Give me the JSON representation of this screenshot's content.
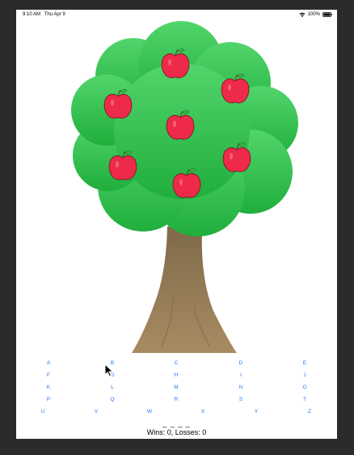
{
  "status": {
    "time": "9:10 AM",
    "date": "Thu Apr 9",
    "battery": "100%",
    "icons": [
      "wifi-icon",
      "battery-icon"
    ]
  },
  "tree": {
    "apple_count": 7,
    "colors": {
      "leaves_top": "#4fd46b",
      "leaves_bottom": "#22b03e",
      "trunk_top": "#7e6a4a",
      "trunk_bottom": "#a88a60",
      "apple": "#ee2a4a"
    }
  },
  "keyboard": {
    "letters": [
      "A",
      "B",
      "C",
      "D",
      "E",
      "F",
      "G",
      "H",
      "I",
      "J",
      "K",
      "L",
      "M",
      "N",
      "O",
      "P",
      "Q",
      "R",
      "S",
      "T",
      "U",
      "V",
      "W",
      "X",
      "Y",
      "Z"
    ],
    "color": "#1a7bf0"
  },
  "game": {
    "word_display": "_ _ _ _",
    "score_text": "Wins: 0, Losses: 0"
  }
}
